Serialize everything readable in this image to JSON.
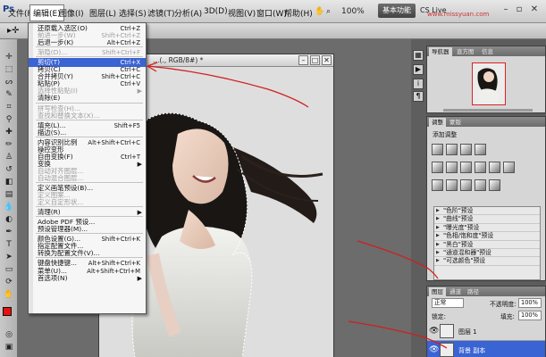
{
  "app": {
    "logo": "Ps"
  },
  "menubar": {
    "items": [
      "文件(F)",
      "编辑(E)",
      "图像(I)",
      "图层(L)",
      "选择(S)",
      "滤镜(T)",
      "分析(A)",
      "3D(D)",
      "视图(V)",
      "窗口(W)",
      "帮助(H)"
    ],
    "zoom": "100%",
    "workspace_button": "基本功能",
    "cs_live": "CS Live",
    "watermark": "www.missyuan.com"
  },
  "document": {
    "title": "…(., RGB/8#) *"
  },
  "edit_menu": {
    "items": [
      {
        "label": "还原载入选区(O)",
        "shortcut": "Ctrl+Z",
        "disabled": false
      },
      {
        "label": "前进一步(W)",
        "shortcut": "Shift+Ctrl+Z",
        "disabled": true
      },
      {
        "label": "后退一步(K)",
        "shortcut": "Alt+Ctrl+Z",
        "disabled": false
      },
      {
        "sep": true
      },
      {
        "label": "渐隐(D)...",
        "shortcut": "Shift+Ctrl+F",
        "disabled": true
      },
      {
        "sep": true
      },
      {
        "label": "剪切(T)",
        "shortcut": "Ctrl+X",
        "disabled": false,
        "highlighted": true
      },
      {
        "label": "拷贝(C)",
        "shortcut": "Ctrl+C",
        "disabled": false
      },
      {
        "label": "合并拷贝(Y)",
        "shortcut": "Shift+Ctrl+C",
        "disabled": false
      },
      {
        "label": "粘贴(P)",
        "shortcut": "Ctrl+V",
        "disabled": false
      },
      {
        "label": "选择性粘贴(I)",
        "shortcut": "",
        "disabled": true,
        "submenu": true
      },
      {
        "label": "清除(E)",
        "shortcut": "",
        "disabled": false
      },
      {
        "sep": true
      },
      {
        "label": "拼写检查(H)...",
        "shortcut": "",
        "disabled": true
      },
      {
        "label": "查找和替换文本(X)...",
        "shortcut": "",
        "disabled": true
      },
      {
        "sep": true
      },
      {
        "label": "填充(L)...",
        "shortcut": "Shift+F5",
        "disabled": false
      },
      {
        "label": "描边(S)...",
        "shortcut": "",
        "disabled": false
      },
      {
        "sep": true
      },
      {
        "label": "内容识别比例",
        "shortcut": "Alt+Shift+Ctrl+C",
        "disabled": false
      },
      {
        "label": "操控变形",
        "shortcut": "",
        "disabled": false
      },
      {
        "label": "自由变换(F)",
        "shortcut": "Ctrl+T",
        "disabled": false
      },
      {
        "label": "变换",
        "shortcut": "",
        "disabled": false,
        "submenu": true
      },
      {
        "label": "自动对齐图层...",
        "shortcut": "",
        "disabled": true
      },
      {
        "label": "自动混合图层...",
        "shortcut": "",
        "disabled": true
      },
      {
        "sep": true
      },
      {
        "label": "定义画笔预设(B)...",
        "shortcut": "",
        "disabled": false
      },
      {
        "label": "定义图案...",
        "shortcut": "",
        "disabled": true
      },
      {
        "label": "定义自定形状...",
        "shortcut": "",
        "disabled": true
      },
      {
        "sep": true
      },
      {
        "label": "清理(R)",
        "shortcut": "",
        "disabled": false,
        "submenu": true
      },
      {
        "sep": true
      },
      {
        "label": "Adobe PDF 预设...",
        "shortcut": "",
        "disabled": false
      },
      {
        "label": "预设管理器(M)...",
        "shortcut": "",
        "disabled": false
      },
      {
        "sep": true
      },
      {
        "label": "颜色设置(G)...",
        "shortcut": "Shift+Ctrl+K",
        "disabled": false
      },
      {
        "label": "指定配置文件...",
        "shortcut": "",
        "disabled": false
      },
      {
        "label": "转换为配置文件(V)...",
        "shortcut": "",
        "disabled": false
      },
      {
        "sep": true
      },
      {
        "label": "键盘快捷键...",
        "shortcut": "Alt+Shift+Ctrl+K",
        "disabled": false
      },
      {
        "label": "菜单(U)...",
        "shortcut": "Alt+Shift+Ctrl+M",
        "disabled": false
      },
      {
        "label": "首选项(N)",
        "shortcut": "",
        "disabled": false,
        "submenu": true
      }
    ]
  },
  "navigator_panel": {
    "tabs": [
      "导航器",
      "直方图",
      "信息"
    ]
  },
  "adjustments_panel": {
    "tabs": [
      "调整",
      "蒙版"
    ],
    "heading": "添加调整",
    "presets": [
      "\"色阶\"预设",
      "\"曲线\"预设",
      "\"曝光度\"预设",
      "\"色相/饱和度\"预设",
      "\"黑白\"预设",
      "\"通道混和器\"预设",
      "\"可选颜色\"预设"
    ]
  },
  "layers_panel": {
    "tabs": [
      "图层",
      "通道",
      "路径"
    ],
    "blend_mode": "正常",
    "opacity_label": "不透明度:",
    "opacity_value": "100%",
    "lock_label": "锁定:",
    "fill_label": "填充:",
    "fill_value": "100%",
    "layers": [
      {
        "name": "图层 1",
        "selected": false
      },
      {
        "name": "背景 副本",
        "selected": true
      }
    ]
  },
  "colors": {
    "foreground": "#e81010",
    "background": "#ffffff",
    "highlight": "#3a63d3",
    "annotation": "#d21e1e"
  }
}
